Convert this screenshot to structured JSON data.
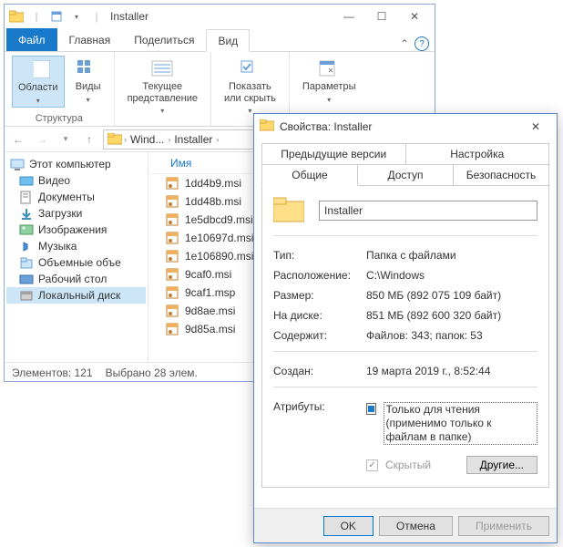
{
  "explorer": {
    "title": "Installer",
    "tabs": {
      "file": "Файл",
      "home": "Главная",
      "share": "Поделиться",
      "view": "Вид"
    },
    "ribbon": {
      "panes": "Области",
      "views": "Виды",
      "current": "Текущее\nпредставление",
      "showhide": "Показать\nили скрыть",
      "options": "Параметры",
      "group_structure": "Структура"
    },
    "address": {
      "crumb1": "Wind...",
      "crumb2": "Installer"
    },
    "tree": {
      "root": "Этот компьютер",
      "items": [
        "Видео",
        "Документы",
        "Загрузки",
        "Изображения",
        "Музыка",
        "Объемные объе",
        "Рабочий стол",
        "Локальный диск"
      ]
    },
    "files": {
      "header": "Имя",
      "items": [
        "1dd4b9.msi",
        "1dd48b.msi",
        "1e5dbcd9.msi",
        "1e10697d.msi",
        "1e106890.msi",
        "9caf0.msi",
        "9caf1.msp",
        "9d8ae.msi",
        "9d85a.msi"
      ]
    },
    "status": {
      "elements": "Элементов: 121",
      "selected": "Выбрано 28 элем."
    }
  },
  "props": {
    "title": "Свойства: Installer",
    "tabs": {
      "prev": "Предыдущие версии",
      "custom": "Настройка",
      "general": "Общие",
      "sharing": "Доступ",
      "security": "Безопасность"
    },
    "name": "Installer",
    "rows": {
      "type_l": "Тип:",
      "type_v": "Папка с файлами",
      "loc_l": "Расположение:",
      "loc_v": "C:\\Windows",
      "size_l": "Размер:",
      "size_v": "850 МБ (892 075 109 байт)",
      "ondisk_l": "На диске:",
      "ondisk_v": "851 МБ (892 600 320 байт)",
      "contains_l": "Содержит:",
      "contains_v": "Файлов: 343; папок: 53",
      "created_l": "Создан:",
      "created_v": "19 марта 2019 г., 8:52:44",
      "attr_l": "Атрибуты:",
      "readonly": "Только для чтения",
      "readonly_note": "(применимо только к файлам в папке)",
      "hidden": "Скрытый",
      "other": "Другие..."
    },
    "buttons": {
      "ok": "OK",
      "cancel": "Отмена",
      "apply": "Применить"
    }
  }
}
